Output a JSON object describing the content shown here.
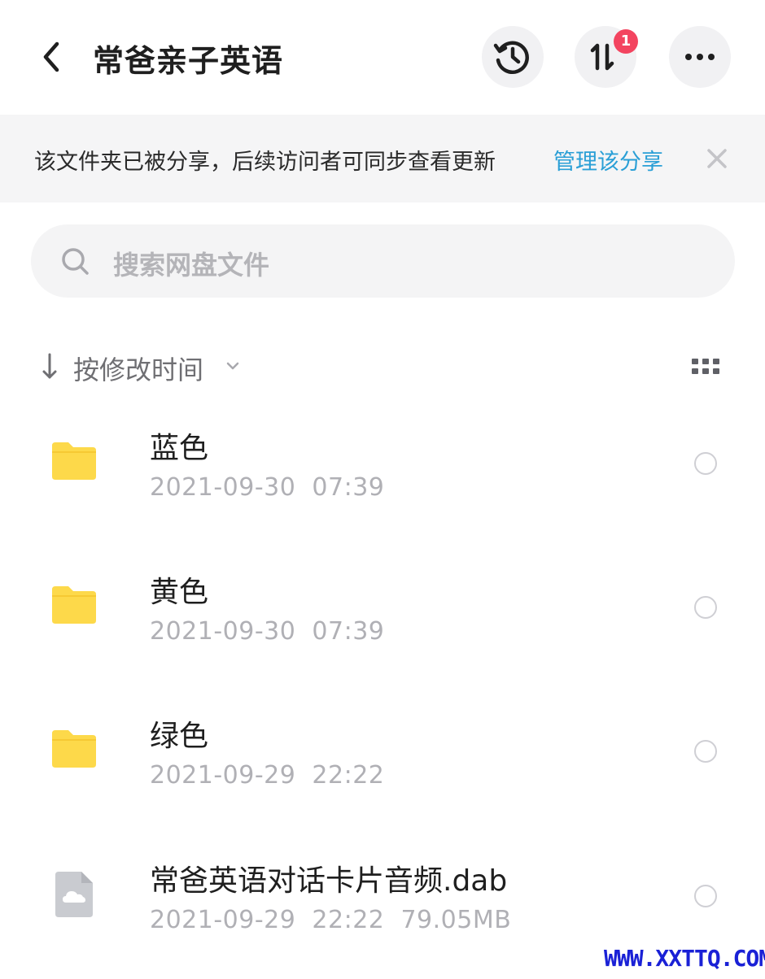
{
  "header": {
    "title": "常爸亲子英语",
    "transfer_badge": "1"
  },
  "banner": {
    "message": "该文件夹已被分享，后续访问者可同步查看更新",
    "link": "管理该分享"
  },
  "search": {
    "placeholder": "搜索网盘文件"
  },
  "sort": {
    "label": "按修改时间"
  },
  "files": [
    {
      "name": "蓝色",
      "meta": "2021-09-30  07:39",
      "type": "folder"
    },
    {
      "name": "黄色",
      "meta": "2021-09-30  07:39",
      "type": "folder"
    },
    {
      "name": "绿色",
      "meta": "2021-09-29  22:22",
      "type": "folder"
    },
    {
      "name": "常爸英语对话卡片音频.dab",
      "meta": "2021-09-29  22:22  79.05MB",
      "type": "file"
    }
  ],
  "watermark": "WWW.XXTTQ.COM",
  "colors": {
    "accent_link": "#2a9fd6",
    "badge": "#f3445f",
    "folder": "#fdd94a"
  }
}
